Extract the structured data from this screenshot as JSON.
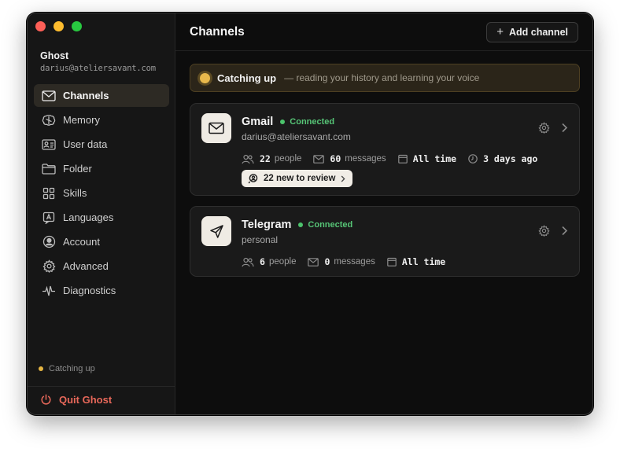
{
  "window": {
    "traffic_lights": [
      "close",
      "minimize",
      "zoom"
    ]
  },
  "profile": {
    "name": "Ghost",
    "email": "darius@ateliersavant.com"
  },
  "sidebar": {
    "items": [
      {
        "label": "Channels",
        "icon": "mail-icon",
        "active": true
      },
      {
        "label": "Memory",
        "icon": "brain-icon",
        "active": false
      },
      {
        "label": "User data",
        "icon": "id-card-icon",
        "active": false
      },
      {
        "label": "Folder",
        "icon": "folder-icon",
        "active": false
      },
      {
        "label": "Skills",
        "icon": "grid-icon",
        "active": false
      },
      {
        "label": "Languages",
        "icon": "language-icon",
        "active": false
      },
      {
        "label": "Account",
        "icon": "user-circle-icon",
        "active": false
      },
      {
        "label": "Advanced",
        "icon": "gear-icon",
        "active": false
      },
      {
        "label": "Diagnostics",
        "icon": "pulse-icon",
        "active": false
      }
    ],
    "status": "Catching up",
    "quit_label": "Quit Ghost"
  },
  "header": {
    "title": "Channels",
    "add_label": "Add channel"
  },
  "banner": {
    "title": "Catching up",
    "subtitle": "— reading your history and learning your voice"
  },
  "channels": [
    {
      "name": "Gmail",
      "status": "Connected",
      "subtitle": "darius@ateliersavant.com",
      "people": "22",
      "people_label": "people",
      "messages": "60",
      "messages_label": "messages",
      "range": "All time",
      "last_sync": "3 days ago",
      "review_label": "22 new to review"
    },
    {
      "name": "Telegram",
      "status": "Connected",
      "subtitle": "personal",
      "people": "6",
      "people_label": "people",
      "messages": "0",
      "messages_label": "messages",
      "range": "All time"
    }
  ],
  "colors": {
    "accent_active": "#2d2a24",
    "status_warning": "#e5b542",
    "status_ok": "#4cc36c",
    "quit": "#e8685a"
  }
}
